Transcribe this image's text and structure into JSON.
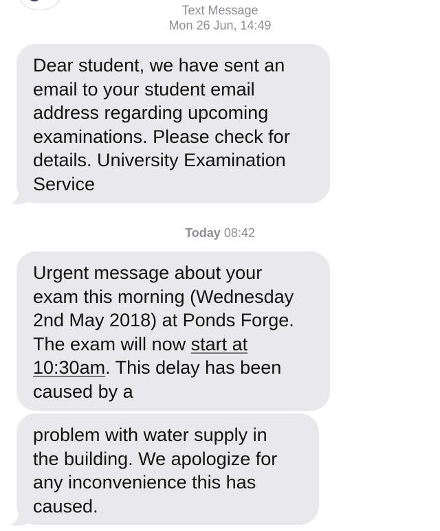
{
  "header": {
    "title": "Text Message",
    "datetime": "Mon 26 Jun, 14:49"
  },
  "messages": [
    {
      "lines": [
        "Dear student, we have sent an",
        "email to your student email",
        "address regarding upcoming",
        "examinations. Please check for",
        "details. University Examination",
        "Service"
      ]
    },
    {
      "line1": "Urgent message about your",
      "line2": "exam this morning (Wednesday",
      "line3": "2nd May 2018) at Ponds Forge.",
      "line4_pre": "The exam will now ",
      "line4_link": "start at",
      "line5_link": "10:30am",
      "line5_post": ". This delay has been",
      "line6": "caused by a"
    },
    {
      "lines": [
        "problem with water supply in",
        "the building. We apologize for",
        "any inconvenience this has",
        "caused."
      ]
    }
  ],
  "divider": {
    "day": "Today",
    "time": "08:42"
  }
}
